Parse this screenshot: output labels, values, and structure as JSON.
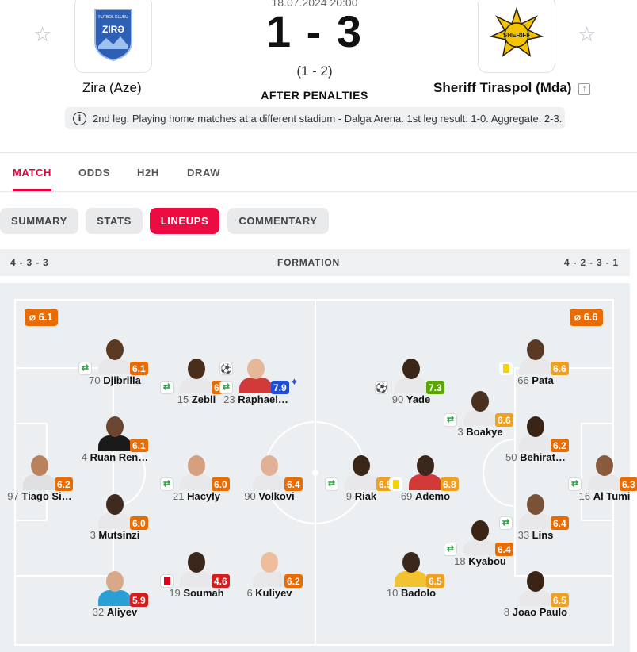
{
  "match": {
    "date": "18.07.2024 20:00",
    "score": "1 - 3",
    "halftime": "(1 - 2)",
    "status": "AFTER PENALTIES",
    "info": "2nd leg. Playing home matches at a different stadium - Dalga Arena. 1st leg result: 1-0. Aggregate: 2-3."
  },
  "home": {
    "name": "Zira (Aze)",
    "formation": "4 - 3 - 3",
    "avg_rating": "⌀ 6.1",
    "logo_text": "ZIRƏ",
    "logo_small": "FUTBOL KLUBU"
  },
  "away": {
    "name": "Sheriff Tiraspol (Mda)",
    "formation": "4 - 2 - 3 - 1",
    "avg_rating": "⌀ 6.6",
    "logo_text": "SHERIFF"
  },
  "tabs": [
    "MATCH",
    "ODDS",
    "H2H",
    "DRAW"
  ],
  "subtabs": [
    "SUMMARY",
    "STATS",
    "LINEUPS",
    "COMMENTARY"
  ],
  "formation_label": "FORMATION",
  "icons": {
    "favorite": "star-icon",
    "info": "info-icon",
    "promoted": "arrow-up-box-icon"
  },
  "colors": {
    "accent": "#e8003c",
    "rating_orange": "#ea6b00",
    "rating_green": "#5aa700",
    "rating_blue": "#1e4fd6",
    "rating_red": "#d71c1c",
    "rating_lightorange": "#f0a020"
  },
  "players": [
    {
      "number": "70",
      "name": "Djibrilla",
      "rating": "6.1",
      "rcolor": "#ea6b00",
      "badge": "sub",
      "skin": "#5a3a22",
      "shirt": "#e8e8ea"
    },
    {
      "number": "15",
      "name": "Zebli",
      "rating": "6.1",
      "rcolor": "#ea6b00",
      "badge": "sub",
      "skin": "#4a2e1c",
      "shirt": "#e8e8ea"
    },
    {
      "number": "23",
      "name": "Raphael…",
      "rating": "7.9",
      "rcolor": "#1e4fd6",
      "badge": "ball-sub",
      "skin": "#e6b89a",
      "shirt": "#d23a3a",
      "star": "✦"
    },
    {
      "number": "4",
      "name": "Ruan Ren…",
      "rating": "6.1",
      "rcolor": "#ea6b00",
      "badge": "",
      "skin": "#6b4532",
      "shirt": "#1a1a1a"
    },
    {
      "number": "97",
      "name": "Tiago Si…",
      "rating": "6.2",
      "rcolor": "#ea6b00",
      "badge": "",
      "skin": "#b9825c",
      "shirt": "#e0e0e2"
    },
    {
      "number": "21",
      "name": "Hacyly",
      "rating": "6.0",
      "rcolor": "#ea6b00",
      "badge": "sub",
      "skin": "#d6a07e",
      "shirt": "#e8e8ea"
    },
    {
      "number": "90",
      "name": "Volkovi",
      "rating": "6.4",
      "rcolor": "#ea6b00",
      "badge": "",
      "skin": "#e1b197",
      "shirt": "#e8e8ea"
    },
    {
      "number": "3",
      "name": "Mutsinzi",
      "rating": "6.0",
      "rcolor": "#ea6b00",
      "badge": "",
      "skin": "#3e2a1e",
      "shirt": "#e8e8ea"
    },
    {
      "number": "19",
      "name": "Soumah",
      "rating": "4.6",
      "rcolor": "#d71c1c",
      "badge": "rcard",
      "skin": "#3b271b",
      "shirt": "#e8e8ea"
    },
    {
      "number": "6",
      "name": "Kuliyev",
      "rating": "6.2",
      "rcolor": "#ea6b00",
      "badge": "",
      "skin": "#edbd9c",
      "shirt": "#e8e8ea"
    },
    {
      "number": "32",
      "name": "Aliyev",
      "rating": "5.9",
      "rcolor": "#d71c1c",
      "badge": "",
      "skin": "#d8a88a",
      "shirt": "#2a9fd6"
    },
    {
      "number": "90",
      "name": "Yade",
      "rating": "7.3",
      "rcolor": "#5aa700",
      "badge": "ball",
      "skin": "#3a2618",
      "shirt": "#e8e8ea"
    },
    {
      "number": "66",
      "name": "Pata",
      "rating": "6.6",
      "rcolor": "#f0a020",
      "badge": "ycard",
      "skin": "#5a3a24",
      "shirt": "#e8e8ea"
    },
    {
      "number": "3",
      "name": "Boakye",
      "rating": "6.6",
      "rcolor": "#f0a020",
      "badge": "sub",
      "skin": "#4a301e",
      "shirt": "#e8e8ea"
    },
    {
      "number": "50",
      "name": "Behirat…",
      "rating": "6.2",
      "rcolor": "#ea6b00",
      "badge": "",
      "skin": "#3a2416",
      "shirt": "#e8e8ea"
    },
    {
      "number": "9",
      "name": "Riak",
      "rating": "6.5",
      "rcolor": "#f0a020",
      "badge": "sub",
      "skin": "#3a2618",
      "shirt": "#e8e8ea"
    },
    {
      "number": "69",
      "name": "Ademo",
      "rating": "6.8",
      "rcolor": "#f0a020",
      "badge": "ycard",
      "skin": "#3b271b",
      "shirt": "#d23a3a"
    },
    {
      "number": "16",
      "name": "Al Tumi",
      "rating": "6.3",
      "rcolor": "#ea6b00",
      "badge": "sub",
      "skin": "#8a5a3c",
      "shirt": "#e8e8ea"
    },
    {
      "number": "33",
      "name": "Lins",
      "rating": "6.4",
      "rcolor": "#ea6b00",
      "badge": "sub",
      "skin": "#7a5238",
      "shirt": "#e8e8ea"
    },
    {
      "number": "18",
      "name": "Kyabou",
      "rating": "6.4",
      "rcolor": "#ea6b00",
      "badge": "sub",
      "skin": "#3a2416",
      "shirt": "#e8e8ea"
    },
    {
      "number": "10",
      "name": "Badolo",
      "rating": "6.5",
      "rcolor": "#f0a020",
      "badge": "",
      "skin": "#3b271b",
      "shirt": "#f2c230"
    },
    {
      "number": "8",
      "name": "Joao Paulo",
      "rating": "6.5",
      "rcolor": "#f0a020",
      "badge": "",
      "skin": "#3a2416",
      "shirt": "#e8e8ea"
    }
  ]
}
